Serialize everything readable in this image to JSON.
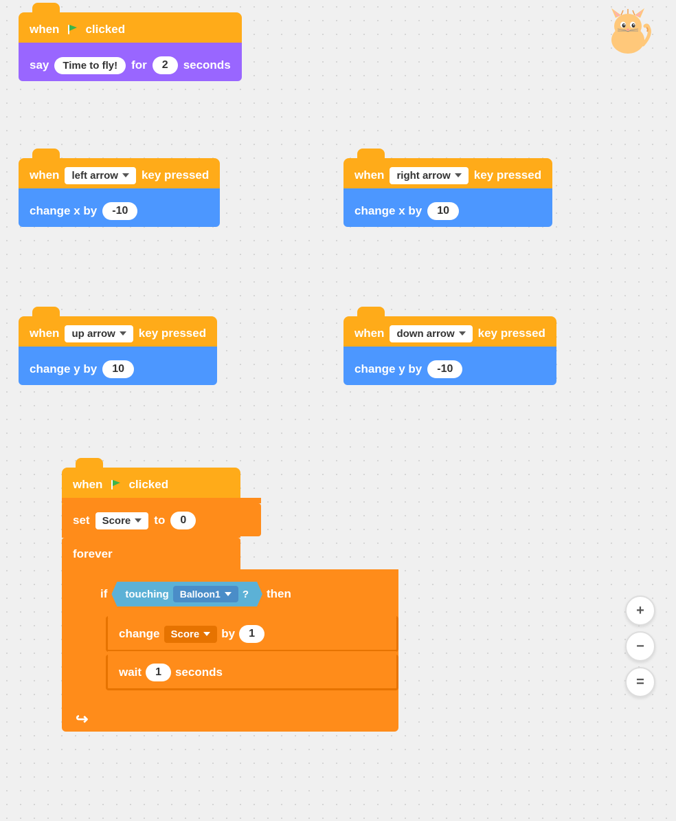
{
  "blocks": {
    "group1": {
      "hat": "when",
      "flag": "🚩",
      "clicked": "clicked",
      "say_label": "say",
      "say_text": "Time to fly!",
      "for_label": "for",
      "seconds_value": "2",
      "seconds_label": "seconds"
    },
    "group2_left": {
      "when": "when",
      "key": "left arrow",
      "pressed": "key pressed",
      "change": "change x by",
      "value": "-10"
    },
    "group2_right": {
      "when": "when",
      "key": "right arrow",
      "pressed": "key pressed",
      "change": "change x by",
      "value": "10"
    },
    "group3_left": {
      "when": "when",
      "key": "up arrow",
      "pressed": "key pressed",
      "change": "change y by",
      "value": "10"
    },
    "group3_right": {
      "when": "when",
      "key": "down arrow",
      "pressed": "key pressed",
      "change": "change y by",
      "value": "-10"
    },
    "group4": {
      "hat": "when",
      "flag": "🚩",
      "clicked": "clicked",
      "set_label": "set",
      "variable": "Score",
      "to_label": "to",
      "set_value": "0",
      "forever_label": "forever",
      "if_label": "if",
      "touching_label": "touching",
      "balloon": "Balloon1",
      "question": "?",
      "then_label": "then",
      "change_label": "change",
      "score_var": "Score",
      "by_label": "by",
      "change_value": "1",
      "wait_label": "wait",
      "wait_value": "1",
      "wait_seconds": "seconds"
    }
  },
  "zoom": {
    "plus": "+",
    "minus": "−",
    "fit": "="
  }
}
